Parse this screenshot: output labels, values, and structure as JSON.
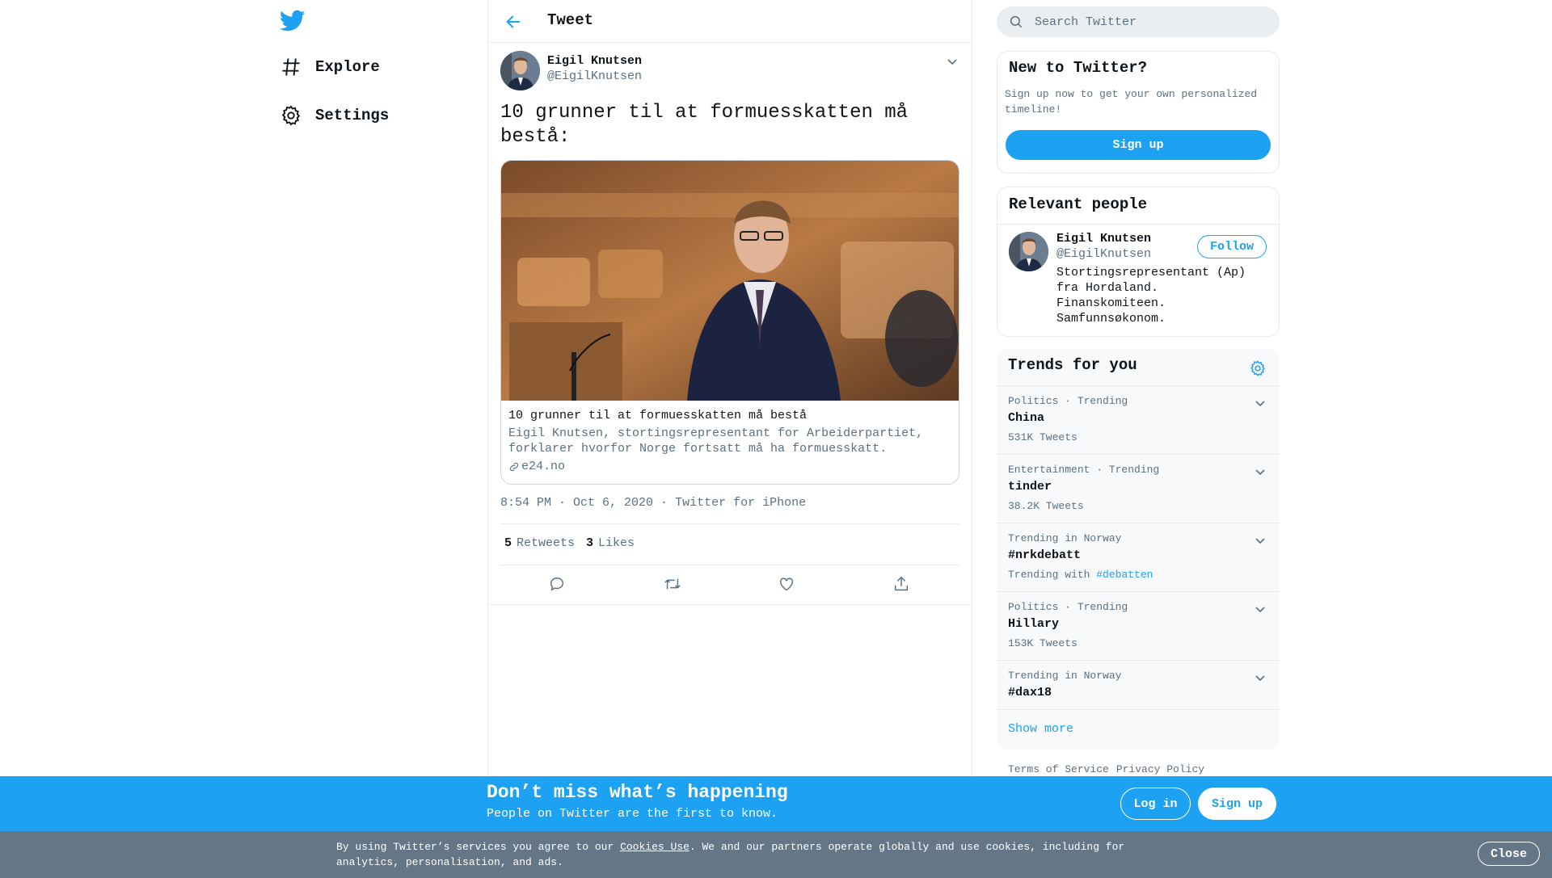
{
  "nav": {
    "items": [
      {
        "label": "Explore",
        "icon": "hashtag-icon"
      },
      {
        "label": "Settings",
        "icon": "gear-icon"
      }
    ]
  },
  "header": {
    "title": "Tweet"
  },
  "tweet": {
    "author_name": "Eigil Knutsen",
    "author_handle": "@EigilKnutsen",
    "text": "10 grunner til at formuesskatten må bestå:",
    "card": {
      "title": "10 grunner til at formuesskatten må bestå",
      "description": "Eigil Knutsen, stortingsrepresentant for Arbeiderpartiet, forklarer hvorfor Norge fortsatt må ha formuesskatt.",
      "domain": "e24.no"
    },
    "timestamp": "8:54 PM · Oct 6, 2020",
    "source": "Twitter for iPhone",
    "retweets_count": "5",
    "retweets_label": "Retweets",
    "likes_count": "3",
    "likes_label": "Likes"
  },
  "search": {
    "placeholder": "Search Twitter"
  },
  "new_to_twitter": {
    "title": "New to Twitter?",
    "subtitle": "Sign up now to get your own personalized timeline!",
    "button": "Sign up"
  },
  "relevant_people": {
    "title": "Relevant people",
    "person": {
      "name": "Eigil Knutsen",
      "handle": "@EigilKnutsen",
      "bio": "Stortingsrepresentant (Ap) fra Hordaland. Finanskomiteen. Samfunnsøkonom.",
      "follow_label": "Follow"
    }
  },
  "trends": {
    "title": "Trends for you",
    "items": [
      {
        "meta": "Politics · Trending",
        "topic": "China",
        "count": "531K Tweets"
      },
      {
        "meta": "Entertainment · Trending",
        "topic": "tinder",
        "count": "38.2K Tweets"
      },
      {
        "meta": "Trending in Norway",
        "topic": "#nrkdebatt",
        "with_prefix": "Trending with",
        "with_tag": "#debatten"
      },
      {
        "meta": "Politics · Trending",
        "topic": "Hillary",
        "count": "153K Tweets"
      },
      {
        "meta": "Trending in Norway",
        "topic": "#dax18"
      }
    ],
    "show_more": "Show more"
  },
  "footer": {
    "terms": "Terms of Service",
    "privacy": "Privacy Policy"
  },
  "banner": {
    "title": "Don’t miss what’s happening",
    "subtitle": "People on Twitter are the first to know.",
    "login": "Log in",
    "signup": "Sign up"
  },
  "cookie": {
    "prefix": "By using Twitter’s services you agree to our",
    "link": "Cookies Use",
    "suffix": ". We and our partners operate globally and use cookies, including for analytics, personalisation, and ads.",
    "close": "Close"
  },
  "colors": {
    "accent": "#1da1f2",
    "cookie_bg": "#657786",
    "muted": "#5b7083"
  }
}
